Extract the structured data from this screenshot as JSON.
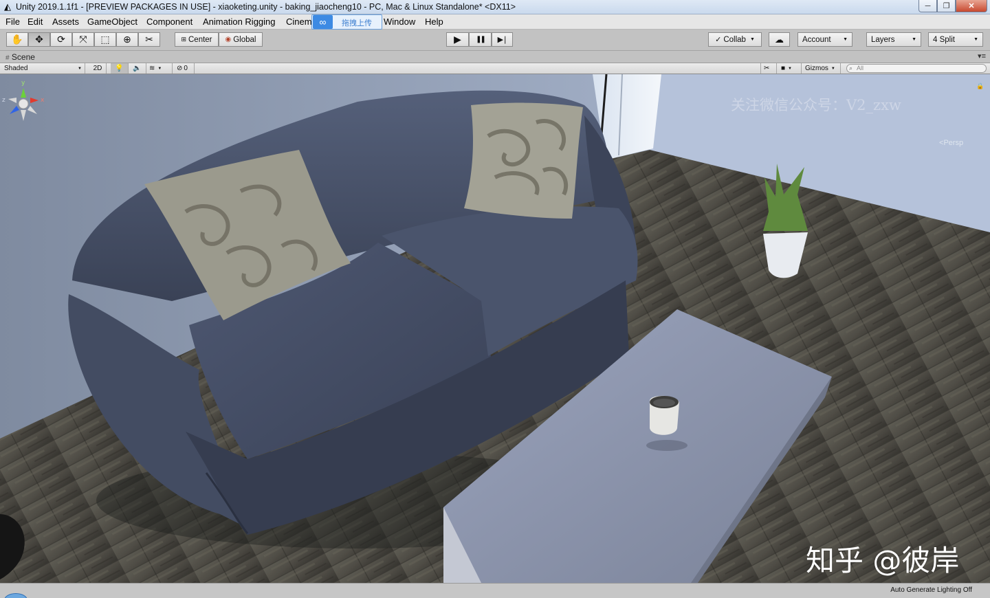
{
  "window": {
    "title": "Unity 2019.1.1f1 - [PREVIEW PACKAGES IN USE] - xiaoketing.unity - baking_jiaocheng10 - PC, Mac & Linux Standalone* <DX11>",
    "controls": {
      "minimize": "─",
      "maximize": "❐",
      "close": "✕"
    }
  },
  "menu": {
    "file": "File",
    "edit": "Edit",
    "assets": "Assets",
    "gameobject": "GameObject",
    "component": "Component",
    "animation_rigging": "Animation Rigging",
    "cinemachine_partial": "Cinem",
    "window": "Window",
    "help": "Help"
  },
  "upload_overlay": {
    "label": "拖拽上传",
    "icon": "cloud-sync-icon"
  },
  "toolbar": {
    "tools": [
      {
        "name": "hand-tool",
        "glyph": "✋"
      },
      {
        "name": "move-tool",
        "glyph": "✥"
      },
      {
        "name": "rotate-tool",
        "glyph": "⟳"
      },
      {
        "name": "scale-tool",
        "glyph": "⤧"
      },
      {
        "name": "rect-tool",
        "glyph": "⬚"
      },
      {
        "name": "transform-tool",
        "glyph": "⊕"
      },
      {
        "name": "custom-tool",
        "glyph": "✂"
      }
    ],
    "pivot_mode": "Center",
    "pivot_rotation": "Global",
    "play": "▶",
    "pause": "❚❚",
    "step": "▶❘",
    "collab": "Collab",
    "cloud_icon": "☁",
    "account": "Account",
    "layers": "Layers",
    "layout": "4 Split"
  },
  "scene_tab": {
    "label": "Scene",
    "icon": "grid-icon",
    "menu": "▾≡"
  },
  "scene_toolbar": {
    "draw_mode": "Shaded",
    "mode_2d": "2D",
    "lighting_icon": "lightbulb-icon",
    "audio_icon": "speaker-icon",
    "effects_icon": "effects-icon",
    "hidden_count": "0",
    "tools_icon": "wrench-icon",
    "camera_icon": "camera-icon",
    "gizmos": "Gizmos",
    "search_placeholder": "All"
  },
  "viewport": {
    "watermark": "关注微信公众号：V2_zxw",
    "persp_label": "Persp",
    "gizmo_axes": {
      "x": "x",
      "y": "y",
      "z": "z"
    },
    "zhihu_watermark": "知乎 @彼岸"
  },
  "status_bar": {
    "message": "Auto Generate Lighting Off"
  },
  "colors": {
    "sofa": "#4a5568",
    "floor": "#5d5a52",
    "wall": "#a8b6cc",
    "table": "#8e96ab",
    "gizmo_x": "#e23a2e",
    "gizmo_y": "#6bd13a",
    "gizmo_z": "#2f63e6"
  }
}
